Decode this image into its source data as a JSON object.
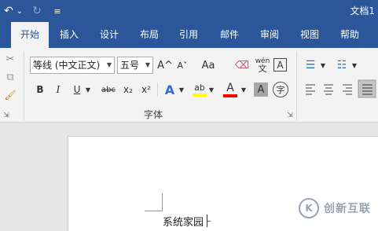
{
  "title_bar": {
    "undo_glyph": "↶",
    "undo_dropdown_glyph": "⌄",
    "redo_glyph": "↻",
    "customize_glyph": "≡",
    "document_title": "文档1"
  },
  "tabs": [
    {
      "label": "开始",
      "active": true
    },
    {
      "label": "插入",
      "active": false
    },
    {
      "label": "设计",
      "active": false
    },
    {
      "label": "布局",
      "active": false
    },
    {
      "label": "引用",
      "active": false
    },
    {
      "label": "邮件",
      "active": false
    },
    {
      "label": "审阅",
      "active": false
    },
    {
      "label": "视图",
      "active": false
    },
    {
      "label": "帮助",
      "active": false
    }
  ],
  "font_group": {
    "font_name": "等线 (中文正文)",
    "font_size": "五号",
    "grow_font_glyph": "A^",
    "shrink_font_glyph": "Aˇ",
    "change_case_glyph": "Aa",
    "clear_format_glyph": "⌫",
    "phonetic_top": "wén",
    "phonetic_bottom": "文",
    "char_border_glyph": "A",
    "bold": "B",
    "italic": "I",
    "underline": "U",
    "strikethrough": "abc",
    "subscript": "x₂",
    "superscript": "x²",
    "text_effects_glyph": "A",
    "highlight_glyph": "ab",
    "font_color_glyph": "A",
    "char_shading_glyph": "A",
    "enclose_char_glyph": "字",
    "group_label": "字体",
    "launcher_glyph": "⇲",
    "highlight_color": "#ffff00",
    "font_color": "#ff0000"
  },
  "clipboard_group": {
    "cut_glyph": "✂",
    "copy_glyph": "⧉",
    "format_painter_glyph": "🖌",
    "launcher_glyph": "⇲"
  },
  "paragraph_group": {
    "bullets_glyph": "☰",
    "numbering_glyph": "☷"
  },
  "document": {
    "text": "系统家园"
  },
  "watermark": {
    "logo_glyph": "K",
    "text": "创新互联"
  }
}
